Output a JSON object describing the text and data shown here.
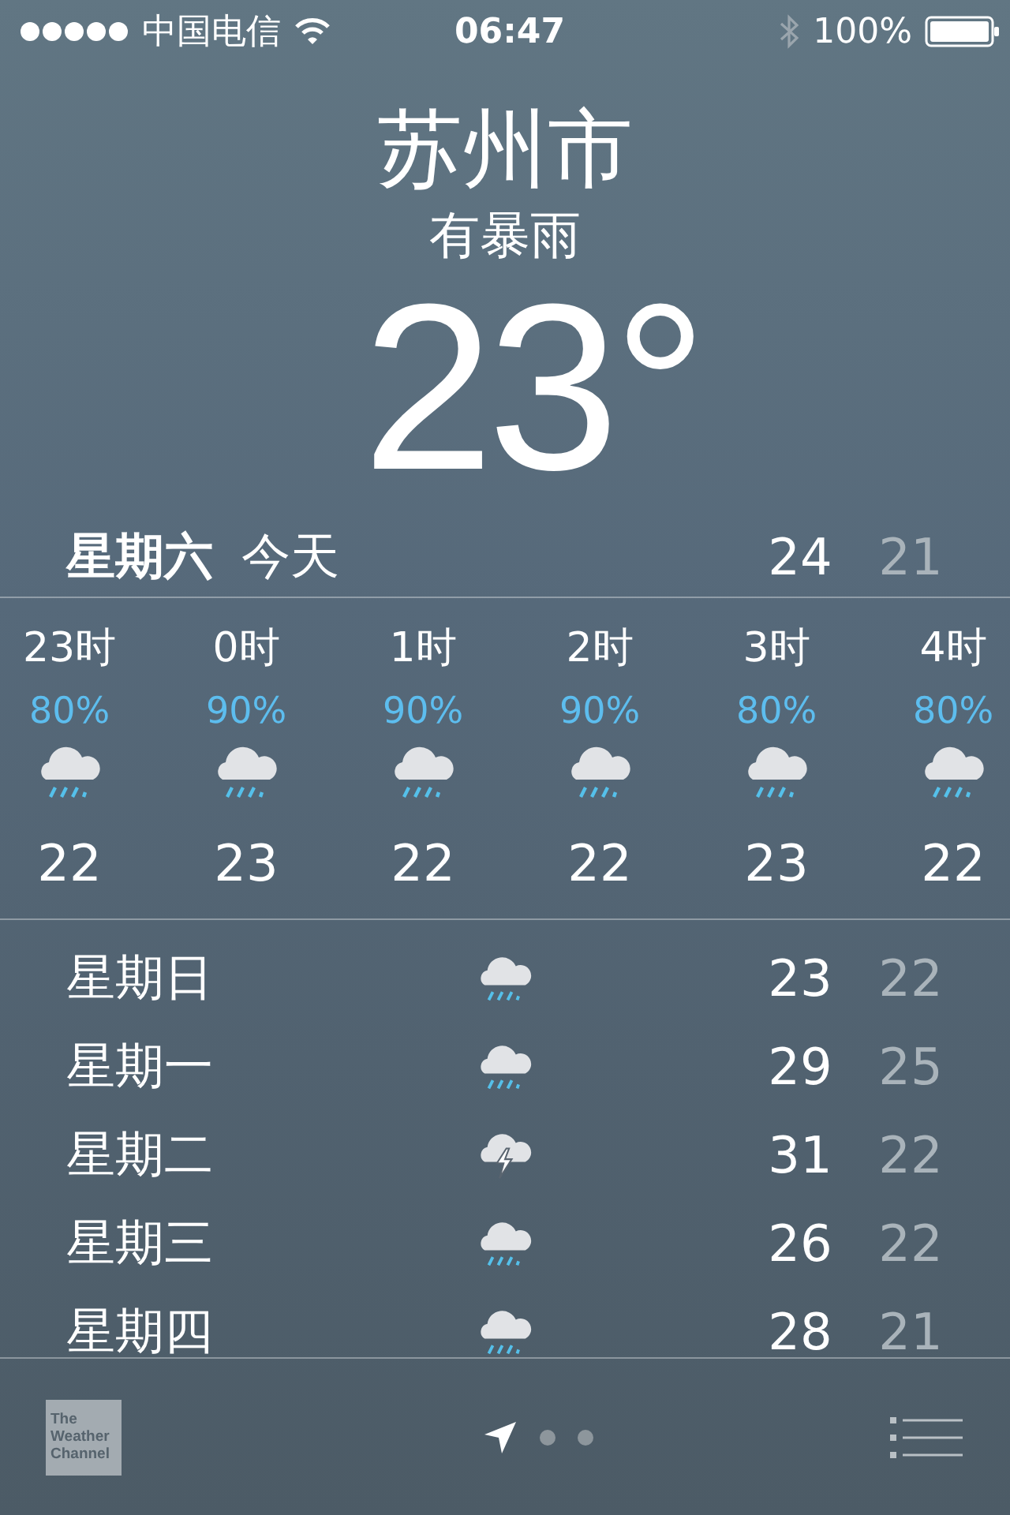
{
  "status_bar": {
    "carrier": "中国电信",
    "time": "06:47",
    "battery": "100%"
  },
  "city": "苏州市",
  "condition": "有暴雨",
  "temperature": "23°",
  "today": {
    "day": "星期六",
    "label": "今天",
    "high": "24",
    "low": "21"
  },
  "hourly": [
    {
      "hour": "23时",
      "chance": "80%",
      "kind": "rain",
      "temp": "22"
    },
    {
      "hour": "0时",
      "chance": "90%",
      "kind": "rain",
      "temp": "23"
    },
    {
      "hour": "1时",
      "chance": "90%",
      "kind": "rain",
      "temp": "22"
    },
    {
      "hour": "2时",
      "chance": "90%",
      "kind": "rain",
      "temp": "22"
    },
    {
      "hour": "3时",
      "chance": "80%",
      "kind": "rain",
      "temp": "23"
    },
    {
      "hour": "4时",
      "chance": "80%",
      "kind": "rain",
      "temp": "22"
    }
  ],
  "daily": [
    {
      "day": "星期日",
      "kind": "rain",
      "high": "23",
      "low": "22"
    },
    {
      "day": "星期一",
      "kind": "rain",
      "high": "29",
      "low": "25"
    },
    {
      "day": "星期二",
      "kind": "thunder",
      "high": "31",
      "low": "22"
    },
    {
      "day": "星期三",
      "kind": "rain",
      "high": "26",
      "low": "22"
    },
    {
      "day": "星期四",
      "kind": "rain",
      "high": "28",
      "low": "21"
    }
  ],
  "bottom_bar": {
    "logo": [
      "The",
      "Weather",
      "Channel"
    ],
    "pages": [
      {
        "kind": "location",
        "selected": true
      },
      {
        "kind": "dot",
        "selected": false
      },
      {
        "kind": "dot",
        "selected": false
      }
    ]
  }
}
